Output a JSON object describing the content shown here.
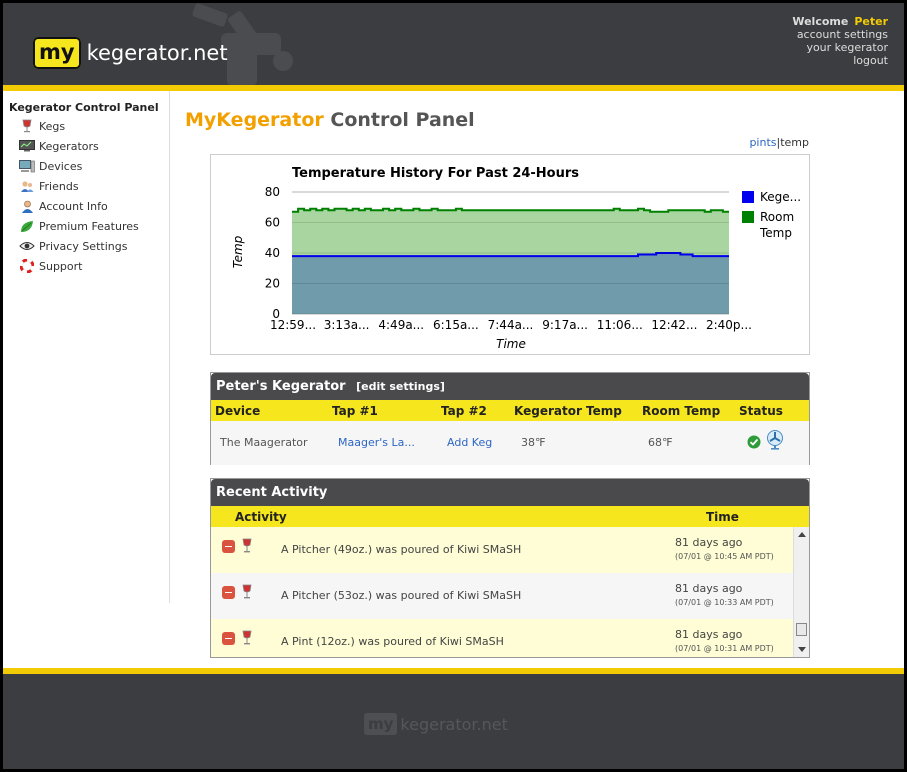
{
  "header": {
    "logo_box": "my",
    "logo_text": "kegerator.net",
    "welcome_label": "Welcome",
    "user_name": "Peter",
    "links": [
      "account settings",
      "your kegerator",
      "logout"
    ]
  },
  "sidebar": {
    "title": "Kegerator Control Panel",
    "items": [
      {
        "label": "Kegs",
        "icon": "wine-glass-icon"
      },
      {
        "label": "Kegerators",
        "icon": "monitor-icon"
      },
      {
        "label": "Devices",
        "icon": "computer-icon"
      },
      {
        "label": "Friends",
        "icon": "users-icon"
      },
      {
        "label": "Account Info",
        "icon": "user-icon"
      },
      {
        "label": "Premium Features",
        "icon": "leaf-icon"
      },
      {
        "label": "Privacy Settings",
        "icon": "eye-icon"
      },
      {
        "label": "Support",
        "icon": "lifebuoy-icon"
      }
    ]
  },
  "page": {
    "title_accent": "MyKegerator",
    "title_rest": " Control Panel",
    "toggle_pints": "pints",
    "toggle_sep": "|",
    "toggle_temp": "temp"
  },
  "chart_data": {
    "type": "area",
    "title": "Temperature History For Past 24-Hours",
    "xlabel": "Time",
    "ylabel": "Temp",
    "ylim": [
      0,
      80
    ],
    "yticks": [
      0,
      20,
      40,
      60,
      80
    ],
    "categories": [
      "12:59...",
      "3:13a...",
      "4:49a...",
      "6:15a...",
      "7:44a...",
      "9:17a...",
      "11:06...",
      "12:42...",
      "2:40p..."
    ],
    "grid": true,
    "legend_position": "right",
    "series": [
      {
        "name": "Kege...",
        "color": "#0000ee",
        "values": [
          38,
          38,
          38,
          38,
          38,
          38,
          38,
          38,
          38,
          38,
          38,
          38,
          38,
          38,
          38,
          38,
          38,
          38,
          38,
          38,
          38,
          38,
          38,
          38,
          38,
          38,
          38,
          38,
          38,
          38,
          38,
          38,
          38,
          38,
          38,
          38,
          38,
          38,
          38,
          38,
          38,
          38,
          38,
          38,
          38,
          38,
          38,
          38,
          38,
          38,
          38,
          38,
          38,
          38,
          38,
          38,
          38,
          39,
          39,
          39,
          40,
          40,
          40,
          40,
          39,
          39,
          38,
          38,
          38,
          38,
          38,
          38,
          38
        ]
      },
      {
        "name": "Room Temp",
        "color": "#008000",
        "values": [
          67,
          69,
          68,
          69,
          68,
          69,
          68,
          69,
          69,
          68,
          69,
          68,
          69,
          68,
          68,
          69,
          68,
          69,
          68,
          68,
          69,
          68,
          68,
          69,
          68,
          68,
          68,
          69,
          68,
          68,
          68,
          68,
          68,
          68,
          68,
          68,
          68,
          68,
          68,
          68,
          68,
          68,
          68,
          68,
          68,
          68,
          68,
          68,
          68,
          68,
          68,
          68,
          68,
          69,
          68,
          68,
          68,
          69,
          68,
          67,
          67,
          67,
          68,
          68,
          68,
          68,
          68,
          68,
          67,
          68,
          68,
          67,
          67
        ]
      }
    ]
  },
  "kegerator": {
    "title": "Peter's Kegerator",
    "edit_label": "[edit settings]",
    "columns": [
      "Device",
      "Tap #1",
      "Tap #2",
      "Kegerator Temp",
      "Room Temp",
      "Status"
    ],
    "row": {
      "device": "The Maagerator",
      "tap1": "Maager's La...",
      "tap2": "Add Keg",
      "kegerator_temp": "38℉",
      "room_temp": "68℉"
    }
  },
  "activity": {
    "title": "Recent Activity",
    "columns": [
      "Activity",
      "Time"
    ],
    "items": [
      {
        "text": "A Pitcher (49oz.) was poured of Kiwi SMaSH",
        "time": "81 days ago",
        "detail": "(07/01 @ 10:45 AM PDT)"
      },
      {
        "text": "A Pitcher (53oz.) was poured of Kiwi SMaSH",
        "time": "81 days ago",
        "detail": "(07/01 @ 10:33 AM PDT)"
      },
      {
        "text": "A Pint (12oz.) was poured of Kiwi SMaSH",
        "time": "81 days ago",
        "detail": "(07/01 @ 10:31 AM PDT)"
      }
    ]
  },
  "footer": {
    "logo_box": "my",
    "logo_text": "kegerator.net"
  }
}
